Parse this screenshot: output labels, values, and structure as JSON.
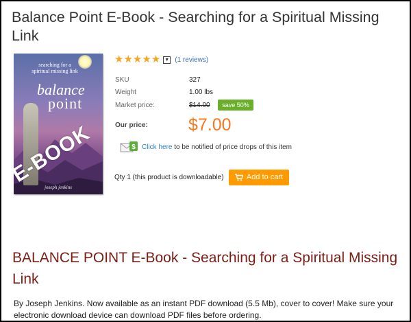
{
  "product": {
    "title": "Balance Point E-Book - Searching for a Spiritual Missing Link",
    "rating": {
      "stars": 5,
      "reviews_label": "(1 reviews)"
    },
    "sku_label": "SKU",
    "sku_value": "327",
    "weight_label": "Weight",
    "weight_value": "1.00 lbs",
    "market_label": "Market price:",
    "market_value": "$14.00",
    "save_badge": "save 50%",
    "our_price_label": "Our price:",
    "our_price_value": "$7.00",
    "notify_link": "Click here",
    "notify_text": "to be notified of price drops of this item",
    "qty_text": "Qty 1 (this product is downloadable)",
    "add_to_cart": "Add to cart"
  },
  "cover": {
    "subtitle_line1": "searching for a",
    "subtitle_line2": "spiritual missing link",
    "title_line1": "balance",
    "title_line2": "point",
    "overlay": "E-BOOK",
    "author": "joseph jenkins"
  },
  "description": {
    "heading": "BALANCE POINT E-Book - Searching for a Spiritual Missing Link",
    "text": "By Joseph Jenkins. Now available as an instant PDF download (5.5 Mb), cover to cover! Make sure your electronic download device can download PDF files before ordering."
  },
  "colors": {
    "price": "#f7781d",
    "stars": "#f5a623",
    "save_badge": "#6aaf2a",
    "cart_button": "#ff9a00",
    "heading": "#7a1e16",
    "link": "#2e82c8"
  },
  "icons": [
    "star-icon",
    "dropdown-icon",
    "envelope-dollar-icon",
    "cart-icon"
  ]
}
